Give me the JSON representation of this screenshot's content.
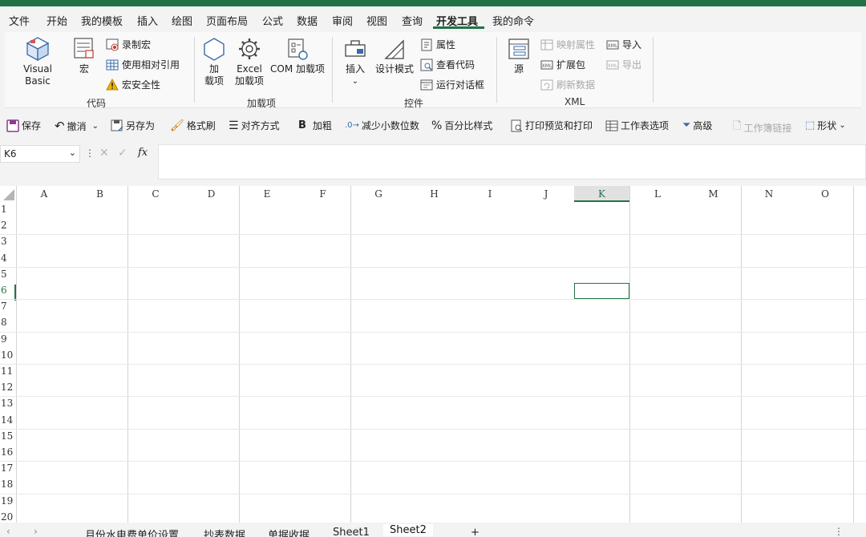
{
  "menu": {
    "tabs": [
      "文件",
      "开始",
      "我的模板",
      "插入",
      "绘图",
      "页面布局",
      "公式",
      "数据",
      "审阅",
      "视图",
      "查询",
      "开发工具",
      "我的命令"
    ],
    "active_index": 11
  },
  "ribbon": {
    "code": {
      "label": "代码",
      "visual_basic": "Visual Basic",
      "macro": "宏",
      "record_macro": "录制宏",
      "relative_ref": "使用相对引用",
      "macro_security": "宏安全性"
    },
    "addins": {
      "label": "加载项",
      "addins_btn": "加\n载项",
      "addins_line1": "加",
      "addins_line2": "载项",
      "excel_line1": "Excel",
      "excel_line2": "加载项",
      "com": "COM 加载项"
    },
    "controls": {
      "label": "控件",
      "insert": "插入",
      "design_mode": "设计模式",
      "properties": "属性",
      "view_code": "查看代码",
      "run_dialog": "运行对话框"
    },
    "xml": {
      "label": "XML",
      "source": "源",
      "map_props": "映射属性",
      "expansion": "扩展包",
      "refresh": "刷新数据",
      "import": "导入",
      "export": "导出"
    }
  },
  "qat": {
    "save": "保存",
    "undo": "撤消",
    "save_as": "另存为",
    "format_painter": "格式刷",
    "align": "对齐方式",
    "bold": "加粗",
    "decrease_decimal": "减少小数位数",
    "percent_style": "百分比样式",
    "print_preview": "打印预览和打印",
    "sheet_options": "工作表选项",
    "advanced": "高级",
    "workbook_links": "工作簿链接",
    "shapes": "形状"
  },
  "formula_bar": {
    "name_box": "K6",
    "fx": "fx",
    "value": ""
  },
  "grid": {
    "columns": [
      "A",
      "B",
      "C",
      "D",
      "E",
      "F",
      "G",
      "H",
      "I",
      "J",
      "K",
      "L",
      "M",
      "N",
      "O"
    ],
    "rows": [
      "1",
      "2",
      "3",
      "4",
      "5",
      "6",
      "7",
      "8",
      "9",
      "10",
      "11",
      "12",
      "13",
      "14",
      "15",
      "16",
      "17",
      "18",
      "19",
      "20"
    ],
    "selected_col": "K",
    "selected_row": "6"
  },
  "sheet_tabs": {
    "tabs": [
      "月份水电费单价设置",
      "抄表数据",
      "单据收据",
      "Sheet1",
      "Sheet2"
    ],
    "active": "Sheet2",
    "add": "+"
  },
  "colors": {
    "accent": "#217346"
  }
}
